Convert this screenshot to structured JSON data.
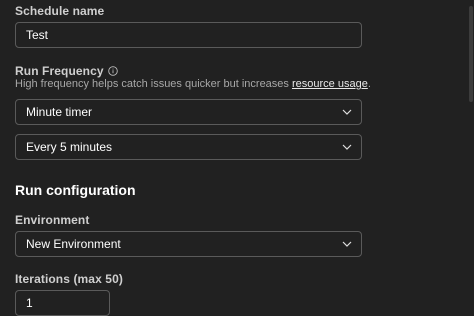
{
  "schedule_name": {
    "label": "Schedule name",
    "value": "Test"
  },
  "run_frequency": {
    "label": "Run Frequency",
    "info_icon": "info-circle-icon",
    "helper_text": "High frequency helps catch issues quicker but increases ",
    "helper_link": "resource usage",
    "helper_suffix": ".",
    "timer_select": "Minute timer",
    "interval_select": "Every 5 minutes"
  },
  "run_configuration": {
    "title": "Run configuration",
    "environment_label": "Environment",
    "environment_select": "New Environment",
    "iterations_label": "Iterations (max 50)",
    "iterations_value": "1"
  },
  "icons": {
    "dropdown": "chevron-down-icon"
  },
  "colors": {
    "background": "#212121",
    "border": "#5a5a5a",
    "text": "#ffffff",
    "muted": "#a8a8a8"
  }
}
